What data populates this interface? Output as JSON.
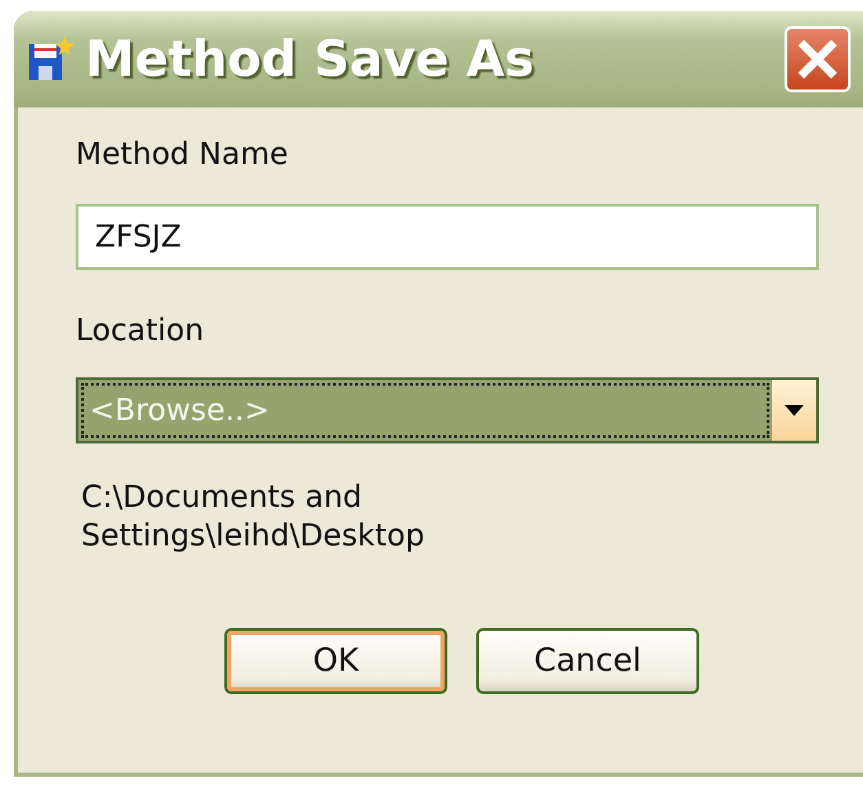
{
  "window": {
    "title": "Method Save As"
  },
  "method_name": {
    "label": "Method Name",
    "value": "ZFSJZ"
  },
  "location": {
    "label": "Location",
    "value": "<Browse..>",
    "focused": true
  },
  "path": "C:\\Documents and Settings\\leihd\\Desktop",
  "buttons": [
    {
      "label": "OK",
      "default": true
    },
    {
      "label": "Cancel",
      "default": false
    }
  ]
}
